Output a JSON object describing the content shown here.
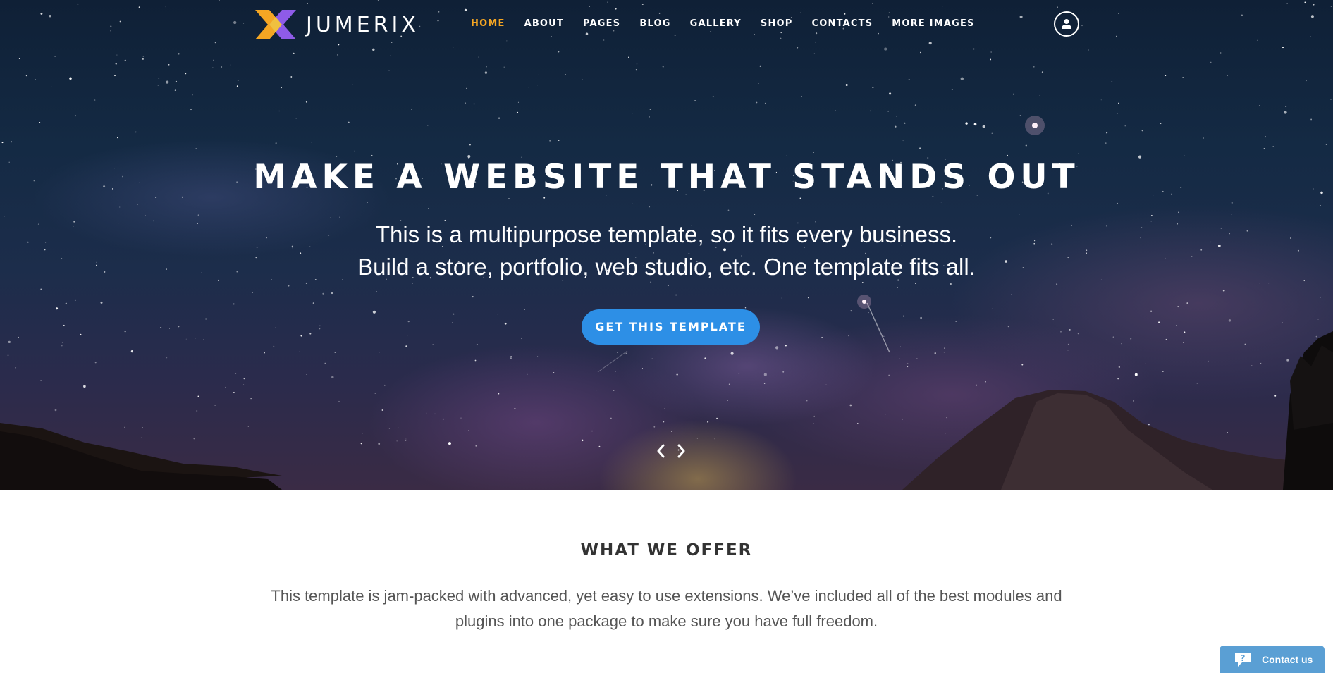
{
  "brand": {
    "name": "JUMERIX",
    "colors": {
      "orange": "#f5a623",
      "purple": "#8e5be8",
      "accent_blue": "#2d8fe6"
    }
  },
  "nav": {
    "items": [
      {
        "label": "HOME",
        "active": true
      },
      {
        "label": "ABOUT",
        "active": false
      },
      {
        "label": "PAGES",
        "active": false
      },
      {
        "label": "BLOG",
        "active": false
      },
      {
        "label": "GALLERY",
        "active": false
      },
      {
        "label": "SHOP",
        "active": false
      },
      {
        "label": "CONTACTS",
        "active": false
      },
      {
        "label": "MORE IMAGES",
        "active": false
      }
    ],
    "user_icon": "user-circle-icon"
  },
  "hero": {
    "title": "MAKE A WEBSITE THAT STANDS OUT",
    "subtitle_line1": "This is a multipurpose template, so it fits every business.",
    "subtitle_line2": "Build a store, portfolio, web studio, etc. One template fits all.",
    "cta_label": "GET THIS TEMPLATE",
    "prev_icon": "chevron-left-icon",
    "next_icon": "chevron-right-icon"
  },
  "offer": {
    "title": "WHAT WE OFFER",
    "text": "This template is jam-packed with advanced, yet easy to use extensions. We’ve included all of the best modules and plugins into one package to make sure you have full freedom."
  },
  "contact_widget": {
    "label": "Contact us",
    "icon": "chat-question-icon"
  }
}
